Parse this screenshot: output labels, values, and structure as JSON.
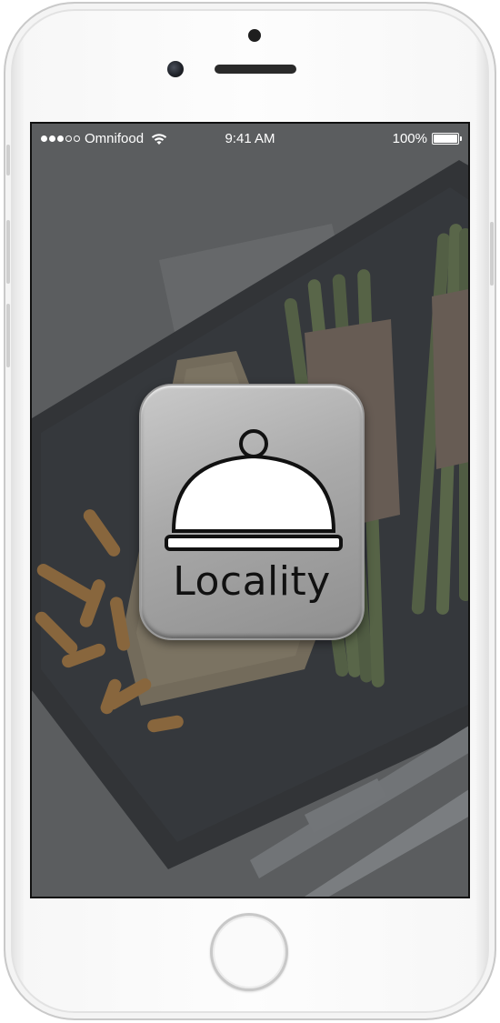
{
  "status_bar": {
    "carrier": "Omnifood",
    "time": "9:41 AM",
    "battery": "100%",
    "signal_icon": "signal-dots-icon",
    "wifi_icon": "wifi-icon",
    "battery_icon": "battery-icon"
  },
  "app": {
    "name": "Locality",
    "icon": "cloche-icon"
  },
  "colors": {
    "overlay": "#5f6163",
    "icon_gradient_top": "#c9c9c9",
    "icon_gradient_bottom": "#8f8f8f"
  }
}
